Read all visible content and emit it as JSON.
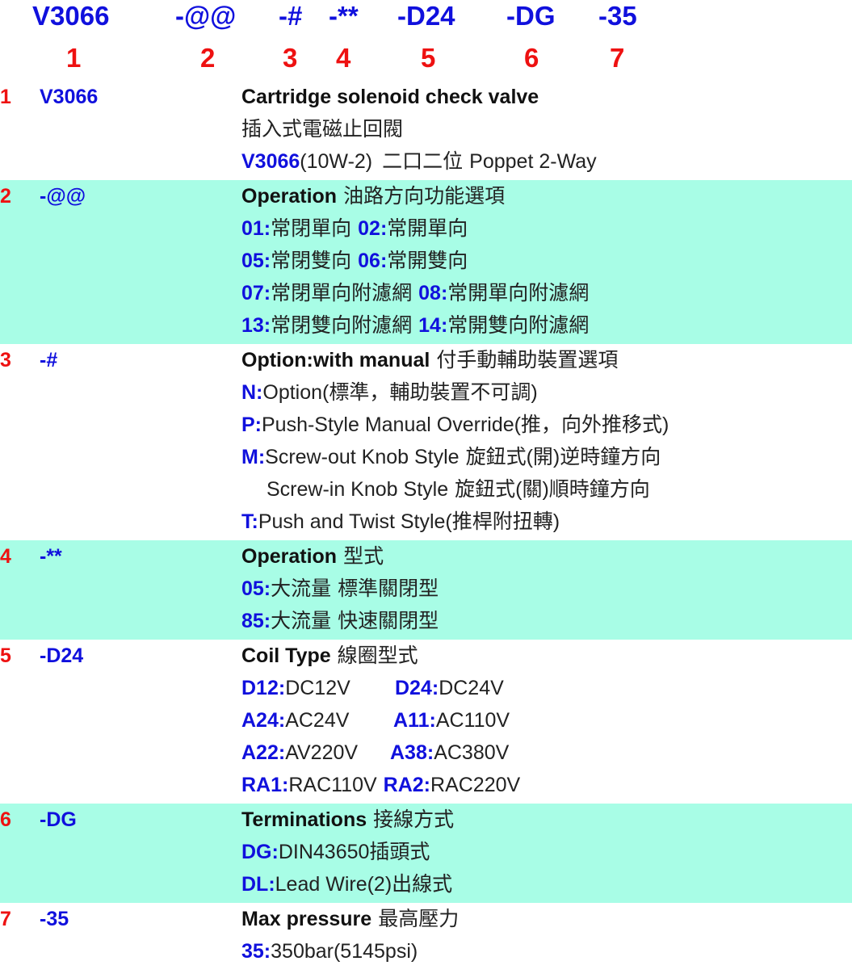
{
  "header": {
    "codes": [
      "V3066",
      "-@@",
      "-#",
      "-**",
      "-D24",
      "-DG",
      "-35"
    ],
    "numbers": [
      "1",
      "2",
      "3",
      "4",
      "5",
      "6",
      "7"
    ]
  },
  "sections": [
    {
      "num": "1",
      "code": "V3066",
      "title": "Cartridge solenoid check valve",
      "cn": "插入式電磁止回閥",
      "model": "V3066",
      "model_spec": "(10W-2)",
      "model_cn": "二口二位",
      "model_desc": "Poppet 2-Way"
    },
    {
      "num": "2",
      "code": "-@@",
      "title": "Operation",
      "title_cn": "油路方向功能選項",
      "pairs": [
        [
          {
            "k": "01:",
            "v": "常閉單向"
          },
          {
            "k": "02:",
            "v": "常開單向"
          }
        ],
        [
          {
            "k": "05:",
            "v": "常閉雙向"
          },
          {
            "k": "06:",
            "v": "常開雙向"
          }
        ],
        [
          {
            "k": "07:",
            "v": "常閉單向附濾網"
          },
          {
            "k": "08:",
            "v": "常開單向附濾網"
          }
        ],
        [
          {
            "k": "13:",
            "v": "常閉雙向附濾網"
          },
          {
            "k": "14:",
            "v": "常開雙向附濾網"
          }
        ]
      ]
    },
    {
      "num": "3",
      "code": "-#",
      "title": "Option:with manual",
      "title_cn": "付手動輔助裝置選項",
      "n_k": "N:",
      "n_en": "Option(",
      "n_cn": "標準，輔助裝置不可調",
      "n_end": ")",
      "p_k": "P:",
      "p_en": "Push-Style Manual Override(",
      "p_cn": "推，向外推移式",
      "p_end": ")",
      "m_k": "M:",
      "m_en": "Screw-out Knob Style",
      "m_cn1": "旋鈕式",
      "m_p1": "(",
      "m_cn2": "開",
      "m_p2": ")",
      "m_cn3": "逆時鐘方向",
      "m2_en": "Screw-in Knob Style",
      "m2_cn1": "旋鈕式",
      "m2_p1": "(",
      "m2_cn2": "關",
      "m2_p2": ")",
      "m2_cn3": "順時鐘方向",
      "t_k": "T:",
      "t_en": "Push and Twist Style(",
      "t_cn": "推桿附扭轉",
      "t_end": ")"
    },
    {
      "num": "4",
      "code": "-**",
      "title": "Operation",
      "title_cn": "型式",
      "items": [
        {
          "k": "05:",
          "v1": "大流量",
          "v2": "標準關閉型"
        },
        {
          "k": "85:",
          "v1": "大流量",
          "v2": "快速關閉型"
        }
      ]
    },
    {
      "num": "5",
      "code": "-D24",
      "title": "Coil Type",
      "title_cn": "線圈型式",
      "pairs": [
        [
          {
            "k": "D12:",
            "v": "DC12V"
          },
          {
            "k": "D24:",
            "v": "DC24V"
          }
        ],
        [
          {
            "k": "A24:",
            "v": "AC24V"
          },
          {
            "k": "A11:",
            "v": "AC110V"
          }
        ],
        [
          {
            "k": "A22:",
            "v": "AV220V"
          },
          {
            "k": "A38:",
            "v": "AC380V"
          }
        ],
        [
          {
            "k": "RA1:",
            "v": "RAC110V"
          },
          {
            "k": "RA2:",
            "v": "RAC220V"
          }
        ]
      ]
    },
    {
      "num": "6",
      "code": "-DG",
      "title": "Terminations",
      "title_cn": "接線方式",
      "items": [
        {
          "k": "DG:",
          "v": "DIN43650",
          "v_cn": "插頭式"
        },
        {
          "k": "DL:",
          "v": "Lead Wire(2)",
          "v_cn": "出線式"
        }
      ]
    },
    {
      "num": "7",
      "code": "-35",
      "title": "Max pressure",
      "title_cn": "最高壓力",
      "k": "35:",
      "v": "350bar(5145psi)"
    }
  ],
  "colors": {
    "code_blue": "#1010dd",
    "number_red": "#ee1111",
    "band_cyan": "#a8fde6",
    "text": "#222222"
  }
}
